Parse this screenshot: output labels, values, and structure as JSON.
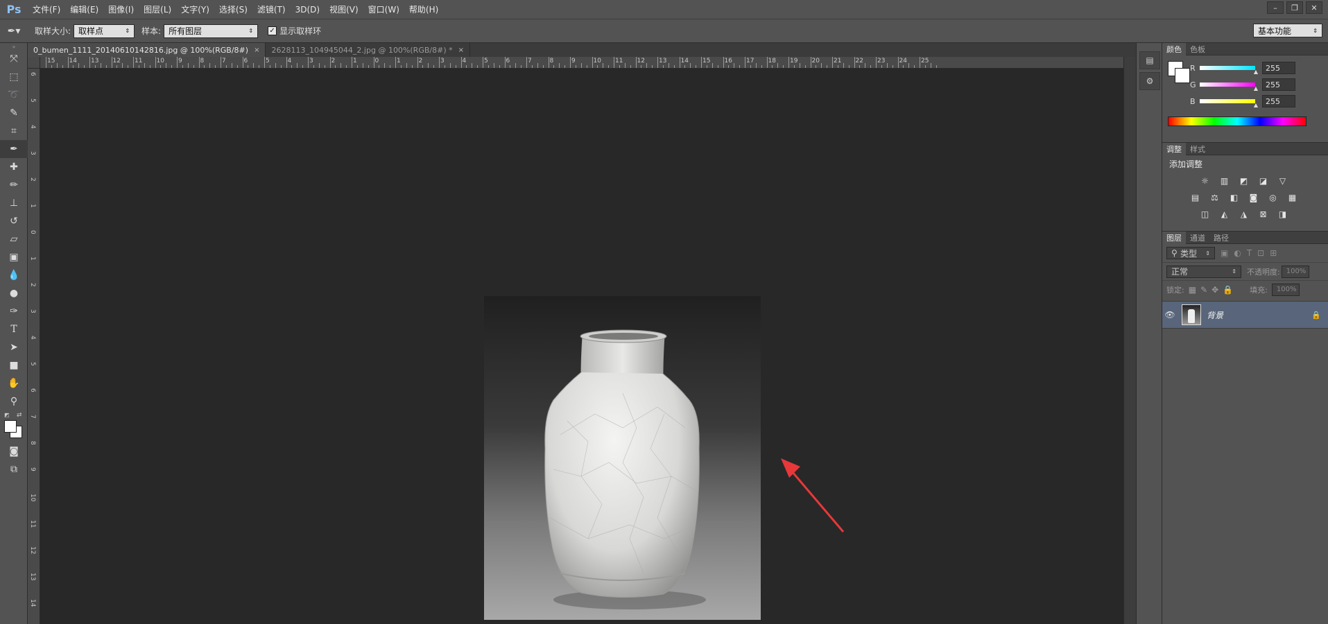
{
  "app": {
    "logo": "Ps"
  },
  "menu": [
    "文件(F)",
    "编辑(E)",
    "图像(I)",
    "图层(L)",
    "文字(Y)",
    "选择(S)",
    "滤镜(T)",
    "3D(D)",
    "视图(V)",
    "窗口(W)",
    "帮助(H)"
  ],
  "window_controls": [
    "–",
    "❐",
    "✕"
  ],
  "options": {
    "sample_size_label": "取样大小:",
    "sample_size_value": "取样点",
    "sample_label": "样本:",
    "sample_value": "所有图层",
    "show_ring_label": "显示取样环",
    "workspace": "基本功能"
  },
  "tabs": [
    {
      "title": "0_bumen_1111_20140610142816.jpg @ 100%(RGB/8#)",
      "close": "×"
    },
    {
      "title": "2628113_104945044_2.jpg @ 100%(RGB/8#) *",
      "close": "×"
    }
  ],
  "ruler_top": [
    "15",
    "14",
    "13",
    "12",
    "11",
    "10",
    "9",
    "8",
    "7",
    "6",
    "5",
    "4",
    "3",
    "2",
    "1",
    "0",
    "1",
    "2",
    "3",
    "4",
    "5",
    "6",
    "7",
    "8",
    "9",
    "10",
    "11",
    "12",
    "13",
    "14",
    "15",
    "16",
    "17",
    "18",
    "19",
    "20",
    "21",
    "22",
    "23",
    "24",
    "25"
  ],
  "ruler_left": [
    "6",
    "5",
    "4",
    "3",
    "2",
    "1",
    "0",
    "1",
    "2",
    "3",
    "4",
    "5",
    "6",
    "7",
    "8",
    "9",
    "10",
    "11",
    "12",
    "13",
    "14"
  ],
  "panels": {
    "color": {
      "tabs": [
        "颜色",
        "色板"
      ],
      "channels": [
        {
          "label": "R",
          "value": "255",
          "color": "#00e5ff"
        },
        {
          "label": "G",
          "value": "255",
          "color": "#ff00ff"
        },
        {
          "label": "B",
          "value": "255",
          "color": "#ffff00"
        }
      ]
    },
    "adjustments": {
      "tabs": [
        "调整",
        "样式"
      ],
      "title": "添加调整",
      "icons_row1": [
        "☼",
        "▥",
        "◩",
        "◪",
        "▽"
      ],
      "icons_row2": [
        "▤",
        "⚖",
        "◧",
        "◙",
        "◎",
        "▦"
      ],
      "icons_row3": [
        "◫",
        "◭",
        "◮",
        "⊠",
        "◨"
      ]
    },
    "layers": {
      "tabs": [
        "图层",
        "通道",
        "路径"
      ],
      "filter_label": "类型",
      "blend_mode": "正常",
      "opacity_label": "不透明度:",
      "opacity_value": "100%",
      "lock_label": "锁定:",
      "fill_label": "填充:",
      "fill_value": "100%",
      "layer_name": "背景"
    }
  }
}
